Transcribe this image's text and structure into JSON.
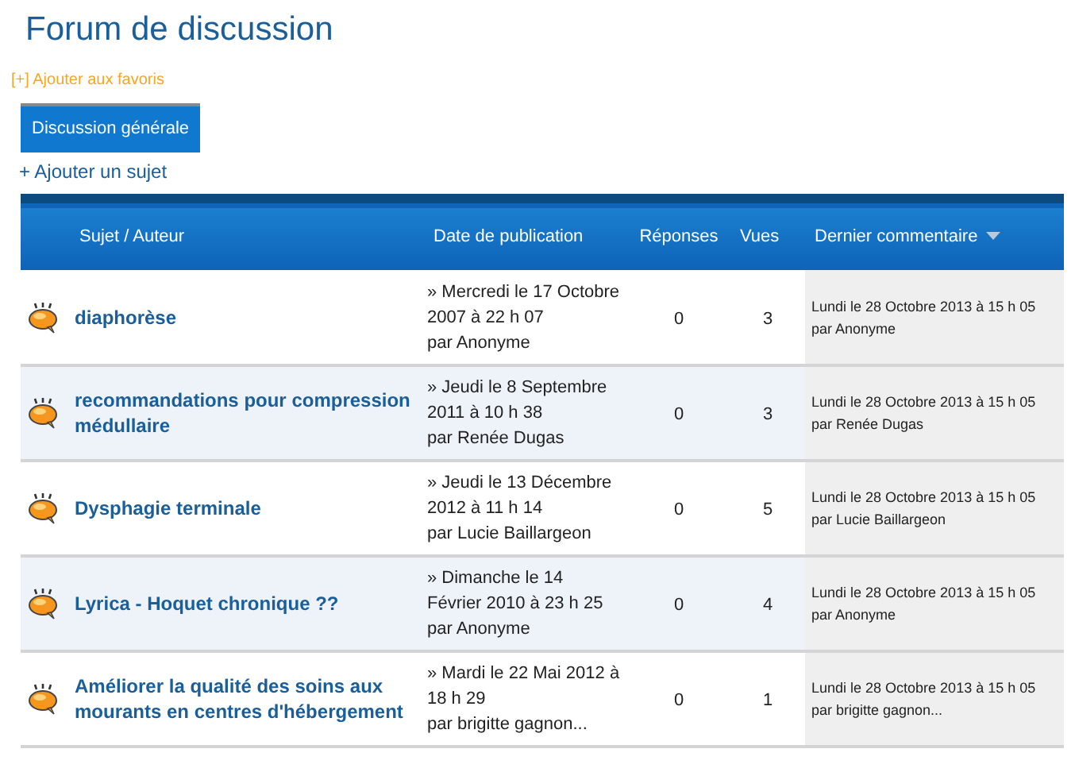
{
  "page_title": "Forum de discussion",
  "favorites_link": "[+] Ajouter aux favoris",
  "tabs": [
    {
      "label": "Discussion générale",
      "selected": true
    }
  ],
  "add_topic_link": "+ Ajouter un sujet",
  "table": {
    "columns": [
      {
        "label": "Sujet / Auteur",
        "sorted": false
      },
      {
        "label": "Date de publication",
        "sorted": false
      },
      {
        "label": "Réponses",
        "sorted": false
      },
      {
        "label": "Vues",
        "sorted": false
      },
      {
        "label": "Dernier commentaire",
        "sorted": true
      }
    ],
    "rows": [
      {
        "subject": "diaphorèse",
        "date": "» Mercredi le 17 Octobre 2007 à 22 h 07",
        "author": "par Anonyme",
        "replies": "0",
        "views": "3",
        "last_date": "Lundi le 28 Octobre 2013 à 15 h 05",
        "last_author": "par Anonyme"
      },
      {
        "subject": "recommandations pour compression médullaire",
        "date": "» Jeudi le 8 Septembre 2011 à 10 h 38",
        "author": "par Renée Dugas",
        "replies": "0",
        "views": "3",
        "last_date": "Lundi le 28 Octobre 2013 à 15 h 05",
        "last_author": "par Renée Dugas"
      },
      {
        "subject": "Dysphagie terminale",
        "date": "» Jeudi le 13 Décembre 2012 à 11 h 14",
        "author": "par Lucie Baillargeon",
        "replies": "0",
        "views": "5",
        "last_date": "Lundi le 28 Octobre 2013 à 15 h 05",
        "last_author": "par Lucie Baillargeon"
      },
      {
        "subject": "Lyrica - Hoquet chronique ??",
        "date": "» Dimanche le 14 Février 2010 à 23 h 25",
        "author": "par Anonyme",
        "replies": "0",
        "views": "4",
        "last_date": "Lundi le 28 Octobre 2013 à 15 h 05",
        "last_author": "par Anonyme"
      },
      {
        "subject": "Améliorer la qualité des soins aux mourants en centres d'hébergement",
        "date": "» Mardi le 22 Mai 2012 à 18 h 29",
        "author": "par brigitte gagnon...",
        "replies": "0",
        "views": "1",
        "last_date": "Lundi le 28 Octobre 2013 à 15 h 05",
        "last_author": "par brigitte gagnon..."
      }
    ]
  }
}
